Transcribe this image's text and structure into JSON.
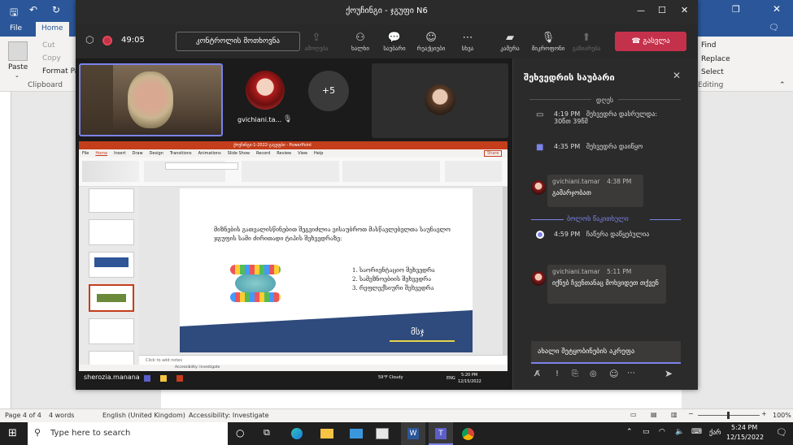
{
  "word": {
    "tabs": [
      "File",
      "Home"
    ],
    "ribbon": {
      "paste": "Paste",
      "cut": "Cut",
      "copy": "Copy",
      "format_painter": "Format Pai",
      "clipboard": "Clipboard",
      "find": "Find",
      "replace": "Replace",
      "select": "Select",
      "editing": "Editing"
    },
    "status": {
      "page": "Page 4 of 4",
      "words": "4 words",
      "language": "English (United Kingdom)",
      "accessibility": "Accessibility: Investigate",
      "zoom_pct": "100%"
    }
  },
  "teams": {
    "title": "ქოუჩინგი - ჯგუფი N6",
    "timer": "49:05",
    "request_control": "კონტროლის მოთხოვნა",
    "toolbar": [
      {
        "icon": "share-tray-icon",
        "label": "ამოღება",
        "dim": true
      },
      {
        "icon": "people-icon",
        "label": "ხალხი"
      },
      {
        "icon": "chat-icon",
        "label": "საუბარი"
      },
      {
        "icon": "reactions-icon",
        "label": "რეაქციები"
      },
      {
        "icon": "more-icon",
        "label": "სხვა"
      },
      {
        "icon": "camera-off-icon",
        "label": "კამერა"
      },
      {
        "icon": "mic-off-icon",
        "label": "მიკროფონი"
      },
      {
        "icon": "share-icon",
        "label": "გაზიარება",
        "dim": true
      }
    ],
    "leave": "გასვლა",
    "participant_name": "gvichiani.ta...",
    "more_participants": "+5",
    "presenter": "sherozia.manana"
  },
  "ppt": {
    "title": "ქოუჩინგი-1-2022-გავეფბი - PowerPoint",
    "tabs": [
      "File",
      "Home",
      "Insert",
      "Draw",
      "Design",
      "Transitions",
      "Animations",
      "Slide Show",
      "Record",
      "Review",
      "View",
      "Help"
    ],
    "share": "Share",
    "slide_text": "მიზნების გათვალისწინებით შეგვიძლია ვისაუბროთ მასწავლებელთა საუნავლო ჯგუფის სამი ძირითადი ტიპის შეხვედრაზე:",
    "list": [
      "1. საორიენტაციო შეხვედრა",
      "2. სამეზნოებიის შეხვედრა",
      "3. რეფლექსიური შეხვედრა"
    ],
    "footer_text": "მსჯ",
    "notes": "Click to add notes",
    "status_left": "Accessibility: Investigate",
    "weather": "59°F Cloudy",
    "lang": "ENG",
    "time": "5:20 PM",
    "date": "12/15/2022"
  },
  "chat": {
    "title": "შეხვედრის საუბარი",
    "today": "დღეს",
    "items": [
      {
        "time": "4:19 PM",
        "text": "შეხვედრა დასრულდა: 30წთ 39წმ"
      },
      {
        "time": "4:35 PM",
        "text": "შეხვედრა დაიწყო"
      }
    ],
    "msg1": {
      "author": "gvichiani.tamar",
      "time": "4:38 PM",
      "text": "გამარჯობათ"
    },
    "last_read": "ბოლოს წაკითხული",
    "item3": {
      "time": "4:59 PM",
      "text": "ჩაწერა დაწყებულია"
    },
    "msg2": {
      "author": "gvichiani.tamar",
      "time": "5:11 PM",
      "text": "იქნებ ჩვენთანაც მოხვიდეთ თქვენ"
    },
    "compose_placeholder": "ახალი შეტყობინების აკრეფა"
  },
  "taskbar": {
    "search": "Type here to search",
    "time": "5:24 PM",
    "date": "12/15/2022",
    "lang": "ქარ"
  },
  "colors": {
    "leave": "#c4314b",
    "teams_accent": "#7b83eb",
    "word_blue": "#2b579a"
  }
}
